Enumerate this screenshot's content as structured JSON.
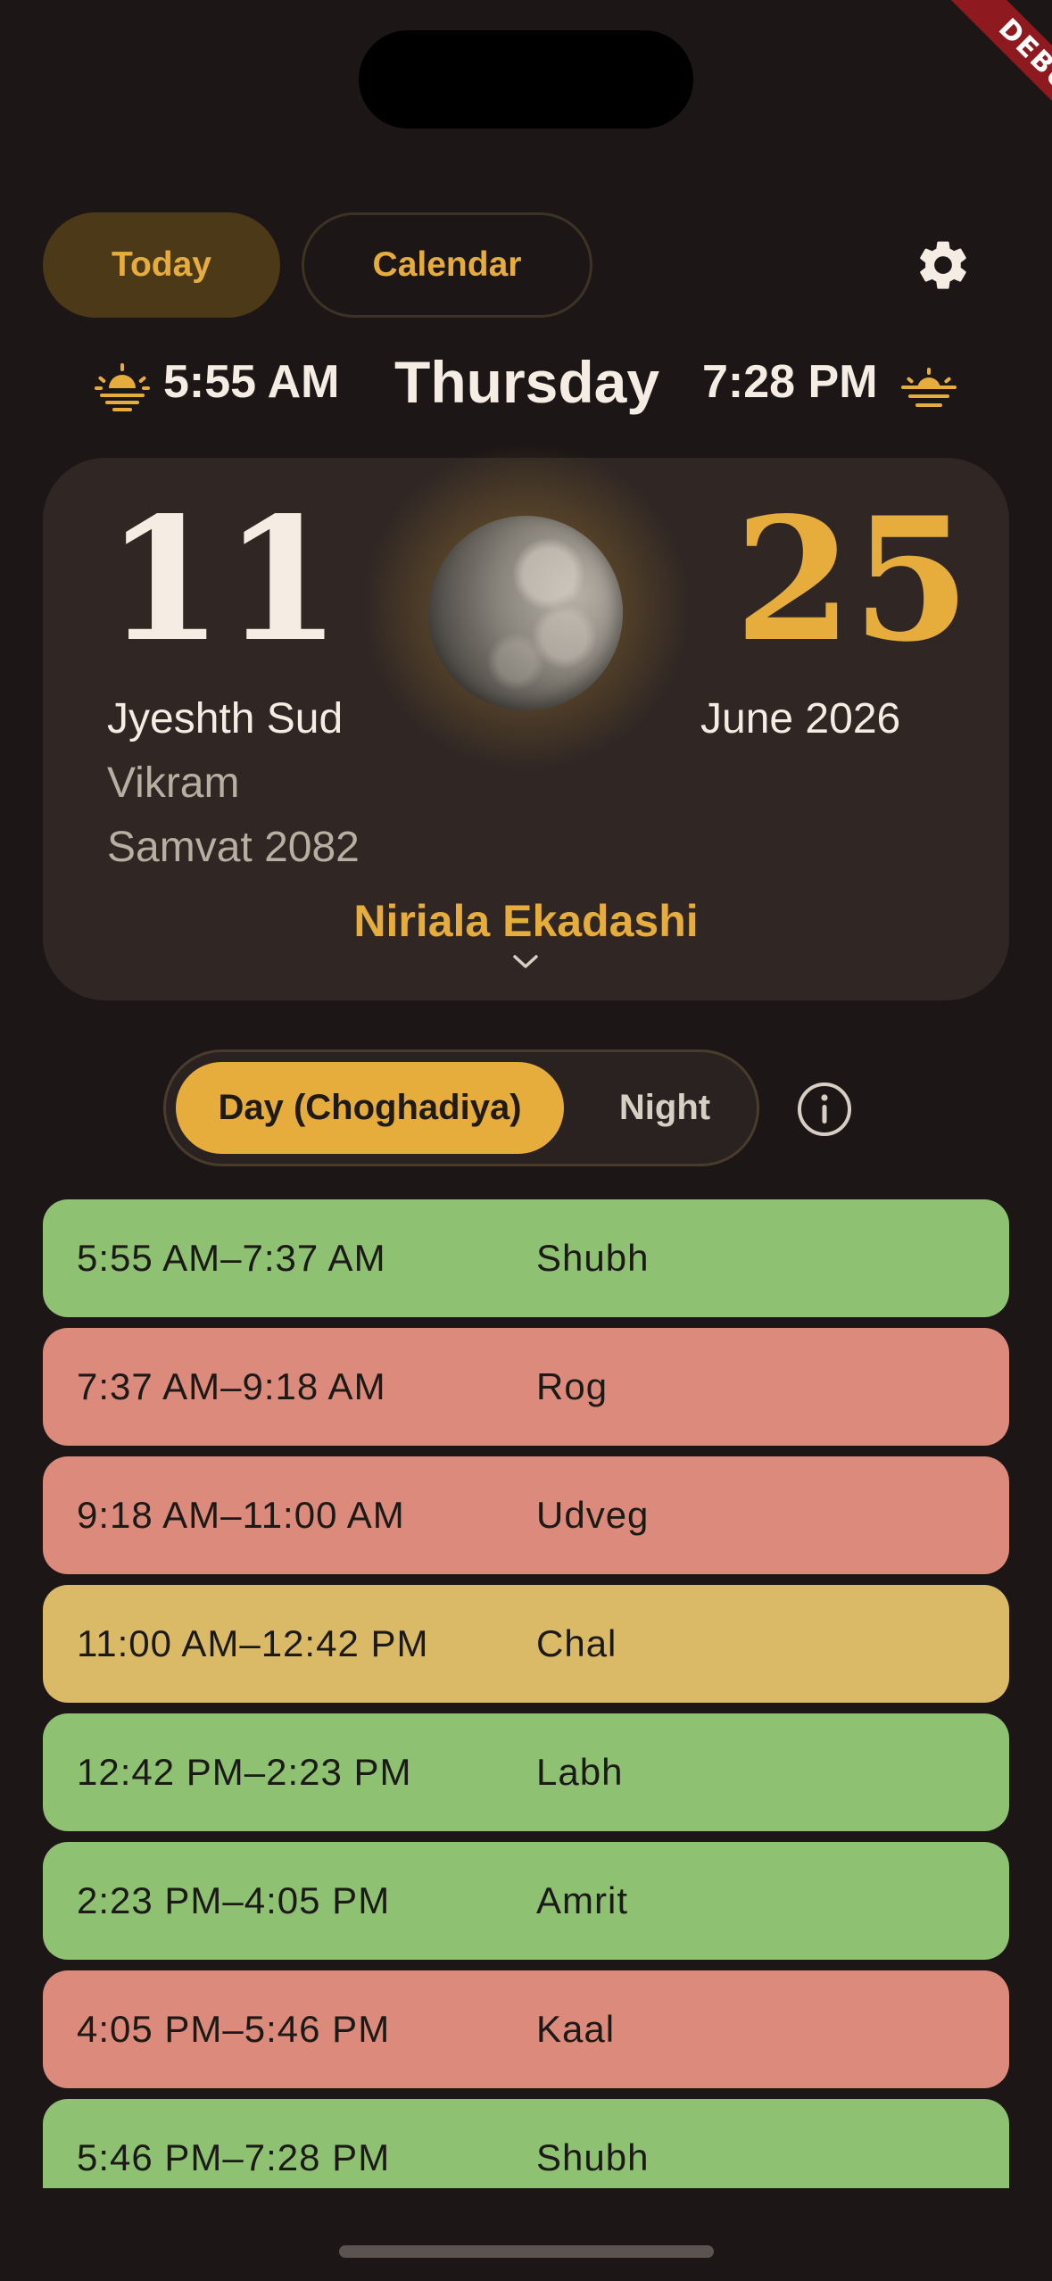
{
  "debug_banner": "DEBUG",
  "tabs": [
    {
      "label": "Today",
      "active": true
    },
    {
      "label": "Calendar",
      "active": false
    }
  ],
  "header": {
    "sunrise": "5:55 AM",
    "weekday": "Thursday",
    "sunset": "7:28 PM"
  },
  "card": {
    "tithi_number": "11",
    "lunar_month": "Jyeshth Sud",
    "lunar_era_line1": "Vikram",
    "lunar_era_line2": "Samvat 2082",
    "gregorian_day": "25",
    "gregorian_month_year": "June 2026",
    "festival": "Niriala Ekadashi"
  },
  "toggle": {
    "day_label": "Day (Choghadiya)",
    "night_label": "Night",
    "selected": "day"
  },
  "choghadiya": [
    {
      "time": "5:55 AM–7:37 AM",
      "name": "Shubh",
      "kind": "good"
    },
    {
      "time": "7:37 AM–9:18 AM",
      "name": "Rog",
      "kind": "bad"
    },
    {
      "time": "9:18 AM–11:00 AM",
      "name": "Udveg",
      "kind": "bad"
    },
    {
      "time": "11:00 AM–12:42 PM",
      "name": "Chal",
      "kind": "neutral"
    },
    {
      "time": "12:42 PM–2:23 PM",
      "name": "Labh",
      "kind": "good"
    },
    {
      "time": "2:23 PM–4:05 PM",
      "name": "Amrit",
      "kind": "good"
    },
    {
      "time": "4:05 PM–5:46 PM",
      "name": "Kaal",
      "kind": "bad"
    },
    {
      "time": "5:46 PM–7:28 PM",
      "name": "Shubh",
      "kind": "good"
    }
  ],
  "colors": {
    "background": "#1c1716",
    "accent": "#e6ad3c",
    "card": "#302724",
    "good": "#8fc173",
    "bad": "#db8a7b",
    "neutral": "#dab967",
    "debug": "#8e1a1f"
  },
  "icons": {
    "settings": "gear-icon",
    "sunrise": "sunrise-icon",
    "sunset": "sunset-icon",
    "info": "info-icon",
    "expand": "chevron-down-icon",
    "moon": "moon-phase-image"
  }
}
